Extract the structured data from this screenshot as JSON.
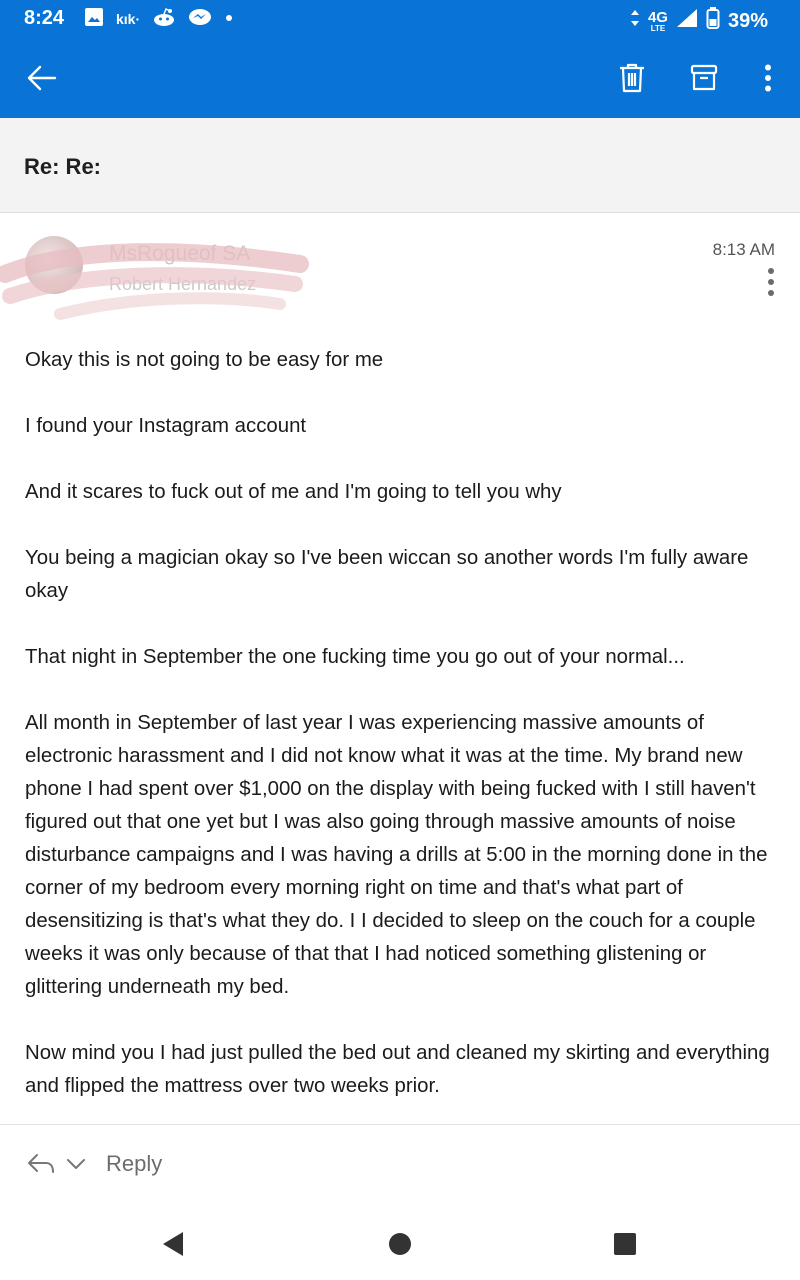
{
  "status_bar": {
    "time": "8:24",
    "kik_label": "kık·",
    "network": "4G",
    "network_sub": "LTE",
    "battery": "39%",
    "icons": [
      "image-icon",
      "kik-icon",
      "reddit-icon",
      "messenger-icon",
      "dot-icon",
      "data-arrows-icon",
      "signal-icon",
      "battery-icon"
    ]
  },
  "app_bar": {
    "icons": [
      "back-arrow-icon",
      "trash-icon",
      "archive-icon",
      "more-vertical-icon"
    ],
    "color": "#0a74d6"
  },
  "email": {
    "subject": "Re: Re:",
    "sender_name": "MsRogueof SA",
    "sender_email": "Robert Hernandez",
    "time": "8:13 AM",
    "paragraphs": [
      "Okay this is not going to be easy for me",
      "I found your Instagram account",
      "And it scares to fuck out of me and I'm going to tell you why",
      "You being a magician okay so I've been wiccan so another words I'm fully aware okay",
      "That night in September the one fucking time you go out of your normal...",
      "All month in September of last year I was experiencing massive amounts of electronic harassment and I did not know what it was at the time. My brand new phone I had spent over $1,000 on the display with being fucked with I still haven't figured out that one yet but I was also going through massive amounts of noise disturbance campaigns and I was having a drills at 5:00 in the morning done in the corner of my bedroom every morning right on time and that's what part of desensitizing is that's what they do. I I decided to sleep on the couch for a couple weeks it was only because of that that I had noticed something glistening or glittering underneath my bed.",
      "Now mind you I had just pulled the bed out and cleaned my skirting and everything and flipped the mattress over two weeks prior."
    ]
  },
  "reply_bar": {
    "label": "Reply",
    "icons": [
      "reply-icon",
      "chevron-down-icon"
    ]
  },
  "nav_bar": {
    "icons": [
      "nav-back-icon",
      "nav-home-icon",
      "nav-recents-icon"
    ]
  }
}
